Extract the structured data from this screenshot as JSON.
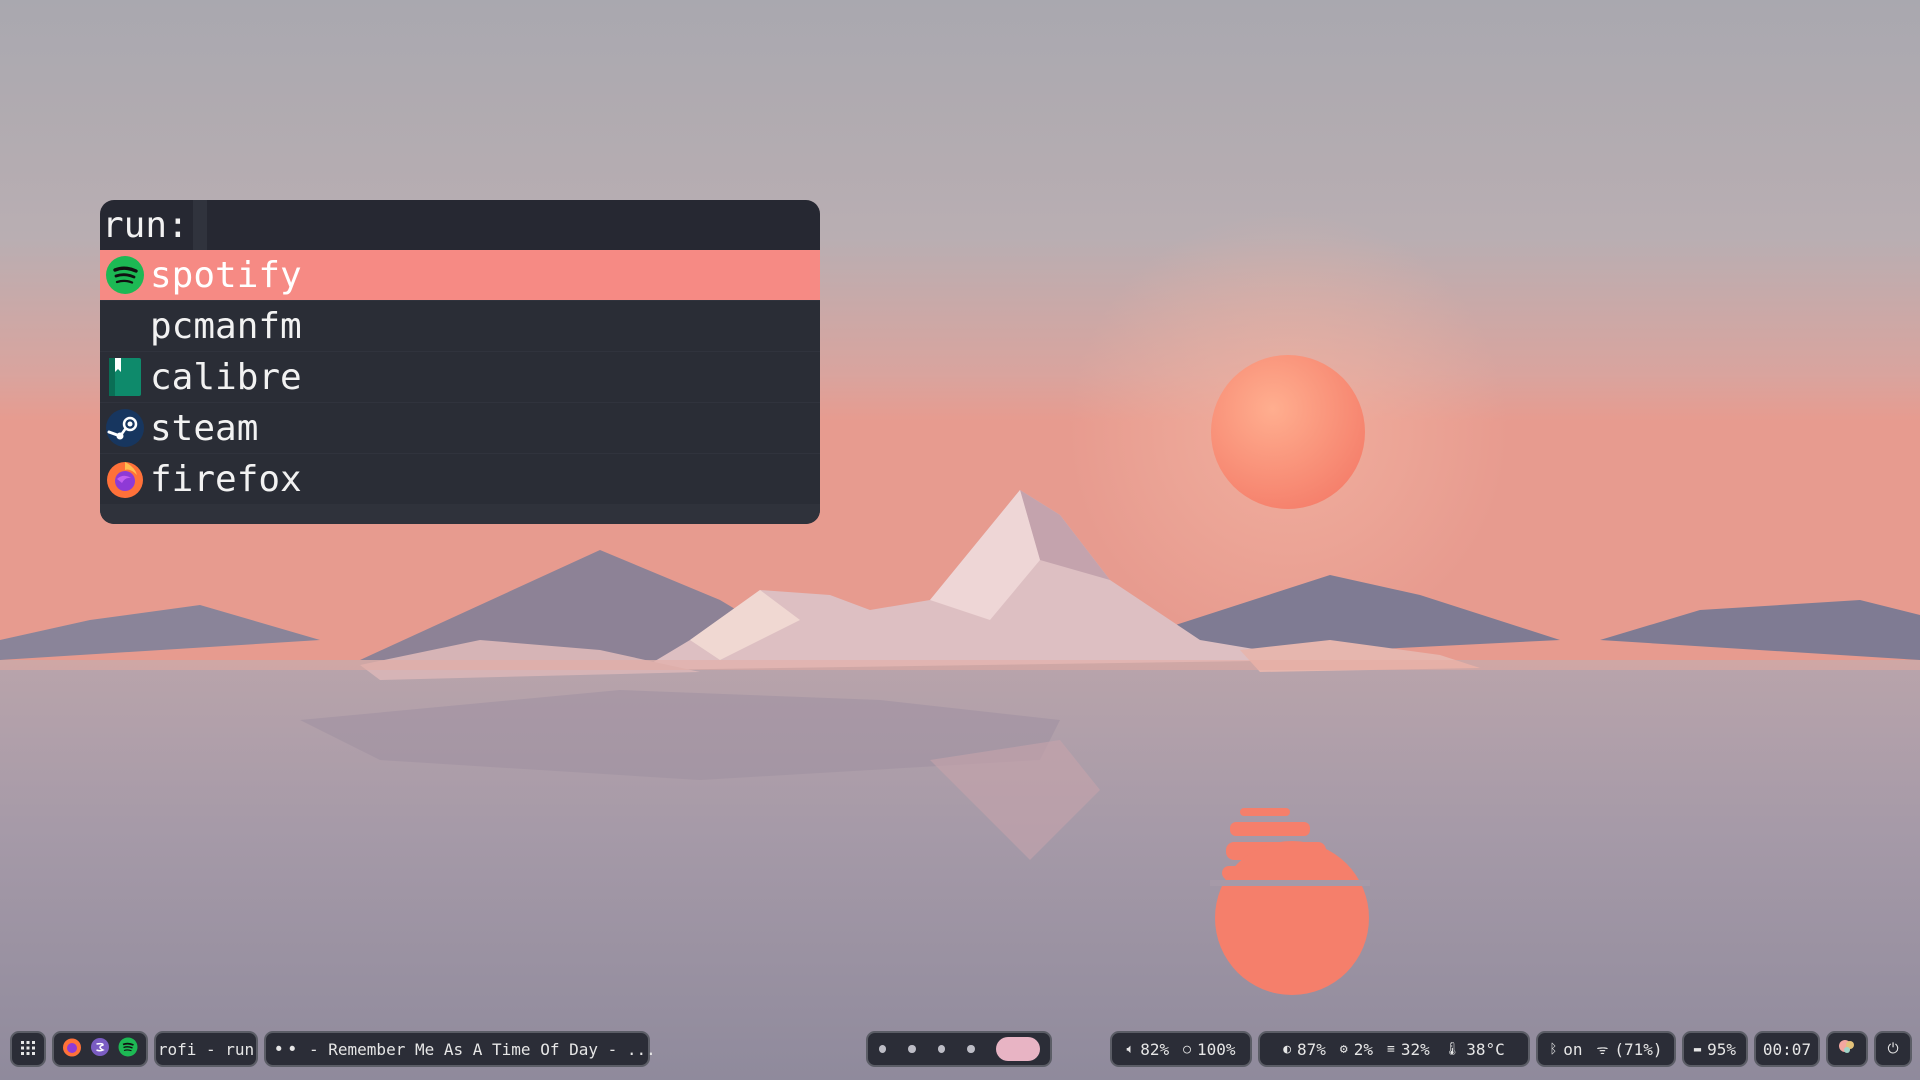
{
  "launcher": {
    "prompt": "run:",
    "entries": [
      {
        "label": "spotify",
        "icon": "spotify-icon"
      },
      {
        "label": "pcmanfm",
        "icon": ""
      },
      {
        "label": "calibre",
        "icon": "calibre-icon"
      },
      {
        "label": "steam",
        "icon": "steam-icon"
      },
      {
        "label": "firefox",
        "icon": "firefox-icon"
      }
    ],
    "selected_index": 0
  },
  "bar": {
    "apps_icon": "app-grid-icon",
    "pinned": [
      "firefox-icon",
      "emacs-icon",
      "spotify-icon"
    ],
    "window_title": "rofi - run",
    "media": {
      "text": "- Remember Me As A Time Of Day - ...",
      "icons": [
        "play-pause-icon",
        "next-icon"
      ]
    },
    "workspaces": {
      "count": 5,
      "active": 5
    },
    "status": {
      "volume": "82%",
      "brightness": "100%",
      "memory_shield": "87%",
      "cpu": "2%",
      "ram": "32%",
      "temperature": "38°C",
      "bluetooth": "on",
      "wifi": "(71%)",
      "battery": "95%",
      "clock": "00:07"
    }
  },
  "colors": {
    "accent": "#f68a84",
    "panel_bg": "#2b2d37",
    "panel_border": "#5b5d66",
    "launcher_bg": "#262832",
    "workspace_active": "#e8b4c4"
  }
}
